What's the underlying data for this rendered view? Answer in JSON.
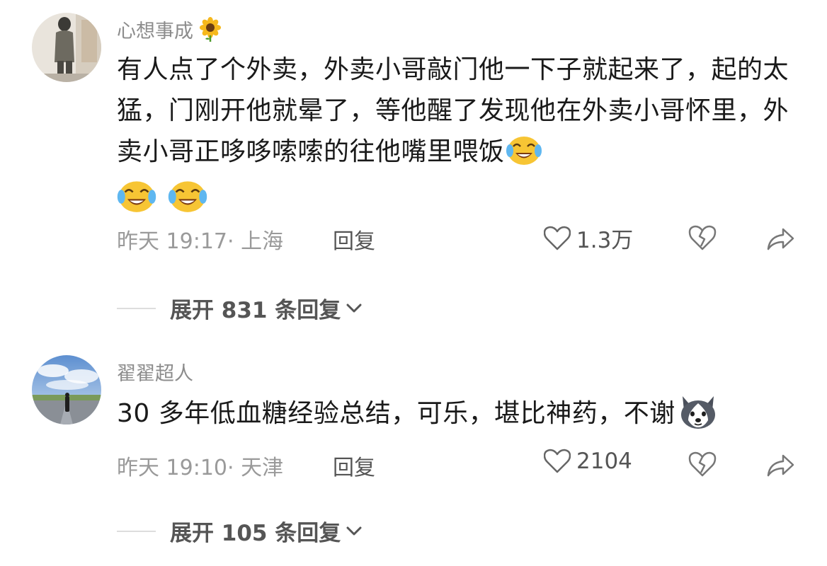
{
  "comments": [
    {
      "username": "心想事成",
      "username_badge_icon": "sunflower-icon",
      "text": "有人点了个外卖，外卖小哥敲门他一下子就起来了，起的太猛，门刚开他就晕了，等他醒了发现他在外卖小哥怀里，外卖小哥正哆哆嗦嗦的往他嘴里喂饭",
      "trailing_emojis": [
        "crying-laughing-emoji",
        "crying-laughing-emoji",
        "crying-laughing-emoji"
      ],
      "time": "昨天 19:17",
      "location": "上海",
      "meta": "昨天 19:17· 上海",
      "reply_label": "回复",
      "like_count": "1.3万",
      "expand_label": "展开 831 条回复"
    },
    {
      "username": "翟翟超人",
      "text": "30 多年低血糖经验总结，可乐，堪比神药，不谢",
      "trailing_emojis": [
        "husky-dog-emoji"
      ],
      "time": "昨天 19:10",
      "location": "天津",
      "meta": "昨天 19:10· 天津",
      "reply_label": "回复",
      "like_count": "2104",
      "expand_label": "展开 105 条回复"
    }
  ],
  "colors": {
    "username": "#8c8c8c",
    "body_text": "#1a1a1a",
    "meta": "#9a9a9a",
    "action": "#555555",
    "emoji_yellow": "#f7c534"
  }
}
